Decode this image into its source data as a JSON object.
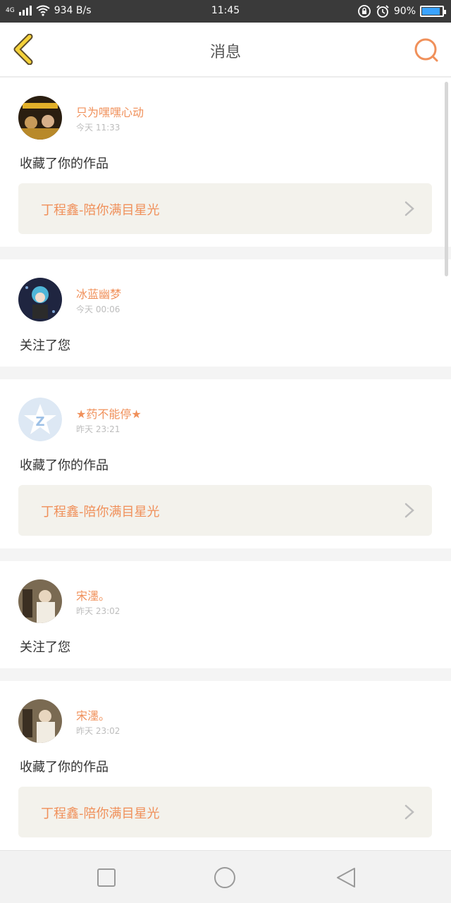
{
  "status_bar": {
    "network": "4G",
    "speed": "934 B/s",
    "time": "11:45",
    "battery": "90%",
    "battery_level": 0.9,
    "icons": [
      "signal-icon",
      "wifi-icon",
      "rotation-lock-icon",
      "alarm-icon",
      "battery-icon"
    ]
  },
  "header": {
    "title": "消息",
    "back_icon": "back-chevron-icon",
    "search_icon": "search-icon"
  },
  "messages": [
    {
      "name": "只为嘿嘿心动",
      "time": "今天 11:33",
      "action": "收藏了你的作品",
      "work": "丁程鑫-陪你满目星光"
    },
    {
      "name": "冰蓝幽梦",
      "time": "今天 00:06",
      "action": "关注了您"
    },
    {
      "name": "★药不能停★",
      "time": "昨天 23:21",
      "action": "收藏了你的作品",
      "work": "丁程鑫-陪你满目星光"
    },
    {
      "name": "宋濹。",
      "time": "昨天 23:02",
      "action": "关注了您"
    },
    {
      "name": "宋濹。",
      "time": "昨天 23:02",
      "action": "收藏了你的作品",
      "work": "丁程鑫-陪你满目星光"
    }
  ],
  "nav_bar": {
    "buttons": [
      "recent-apps-icon",
      "home-icon",
      "back-icon"
    ]
  },
  "colors": {
    "accent": "#f0905a",
    "status_bar_bg": "#3a3a3a",
    "work_card_bg": "#f3f2ec",
    "battery_fill": "#3aa3ff"
  }
}
